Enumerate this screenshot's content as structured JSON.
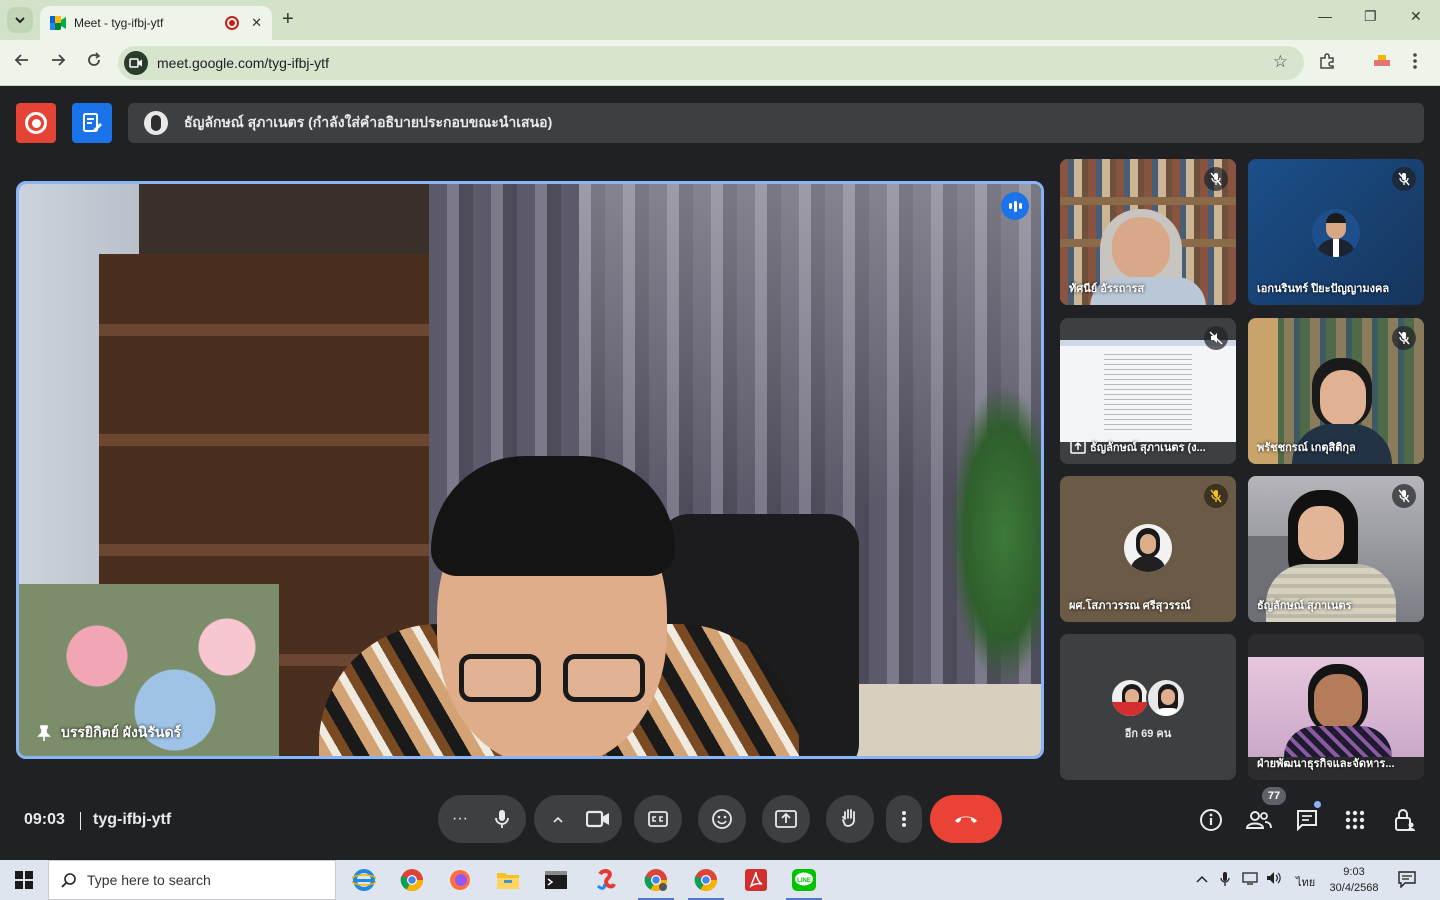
{
  "browser": {
    "tab_title": "Meet - tyg-ifbj-ytf",
    "tab_close": "✕",
    "new_tab": "+",
    "url": "meet.google.com/tyg-ifbj-ytf",
    "window_controls": [
      "—",
      "❐",
      "✕"
    ]
  },
  "meet": {
    "presenter_text": "ธัญลักษณ์ สุภาเนตร (กำลังใส่คำอธิบายประกอบขณะนำเสนอ)",
    "main_speaker": "บรรยิกิตย์ ผังนิรันดร์",
    "tiles": [
      {
        "name": "ทัศนีย์ อัรรถารส",
        "muted": true
      },
      {
        "name": "เอกนรินทร์ ปิยะปัญญามงคล",
        "muted": true
      },
      {
        "name": "ธัญลักษณ์ สุภาเนตร (ง...",
        "muted": true,
        "presenting": true
      },
      {
        "name": "พรัชชกรณ์ เกตุสิติกุล",
        "muted": true
      },
      {
        "name": "ผศ.โสภาวรรณ ศรีสุวรรณ์",
        "muted": true
      },
      {
        "name": "ธัญลักษณ์ สุภาเนตร",
        "muted": true
      },
      {
        "name": "ฝ่ายพัฒนาธุรกิจและจัดหาร...",
        "muted": false
      }
    ],
    "others_label": "อีก 69 คน",
    "time": "09:03",
    "meeting_code": "tyg-ifbj-ytf",
    "participant_count": "77"
  },
  "taskbar": {
    "search_placeholder": "Type here to search",
    "language": "ไทย",
    "time": "9:03",
    "date": "30/4/2568"
  },
  "colors": {
    "accent": "#8ab4f8",
    "hangup": "#ea4335",
    "record": "#e54335",
    "captions": "#1a73e8"
  }
}
